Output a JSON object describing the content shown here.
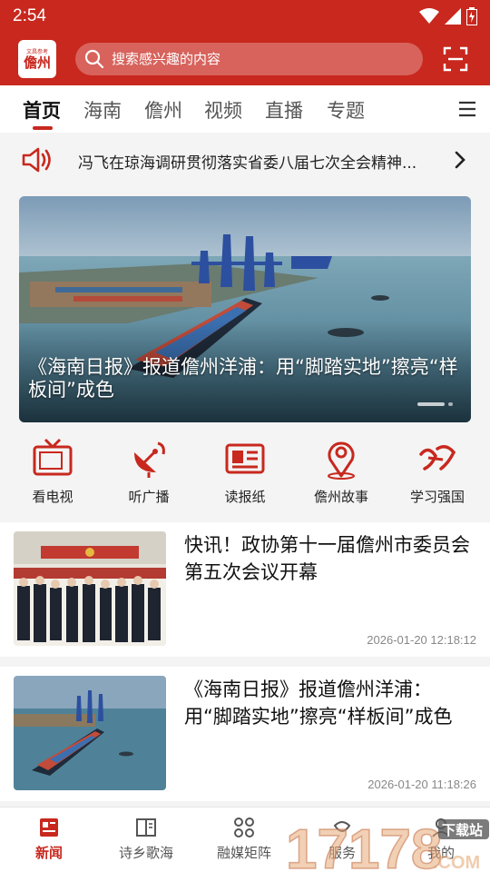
{
  "status_bar": {
    "time": "2:54"
  },
  "header": {
    "logo": {
      "small_text": "文昌参考",
      "big_text": "儋州"
    },
    "search_placeholder": "搜索感兴趣的内容"
  },
  "tabs": [
    {
      "label": "首页",
      "active": true
    },
    {
      "label": "海南",
      "active": false
    },
    {
      "label": "儋州",
      "active": false
    },
    {
      "label": "视频",
      "active": false
    },
    {
      "label": "直播",
      "active": false
    },
    {
      "label": "专题",
      "active": false
    }
  ],
  "notice": {
    "text": "冯飞在琼海调研贯彻落实省委八届七次全会精神..."
  },
  "banner": {
    "caption": "《海南日报》报道儋州洋浦：用“脚踏实地”擦亮“样板间”成色"
  },
  "quick_nav": [
    {
      "label": "看电视",
      "icon": "tv-icon"
    },
    {
      "label": "听广播",
      "icon": "radio-dish-icon"
    },
    {
      "label": "读报纸",
      "icon": "newspaper-icon"
    },
    {
      "label": "儋州故事",
      "icon": "location-pin-icon"
    },
    {
      "label": "学习强国",
      "icon": "xuexi-logo-icon"
    }
  ],
  "news": [
    {
      "title": "快讯！政协第十一届儋州市委员会第五次会议开幕",
      "time": "2026-01-20 12:18:12"
    },
    {
      "title": "《海南日报》报道儋州洋浦：用“脚踏实地”擦亮“样板间”成色",
      "time": "2026-01-20 11:18:26"
    }
  ],
  "bottom_nav": [
    {
      "label": "新闻",
      "icon": "news-icon",
      "active": true
    },
    {
      "label": "诗乡歌海",
      "icon": "book-icon",
      "active": false
    },
    {
      "label": "融媒矩阵",
      "icon": "grid-icon",
      "active": false
    },
    {
      "label": "服务",
      "icon": "service-icon",
      "active": false
    },
    {
      "label": "我的",
      "icon": "user-icon",
      "active": false
    }
  ],
  "watermark": {
    "number": "17178",
    "suffix": ".COM",
    "badge": "下载站"
  },
  "colors": {
    "brand_red": "#c8281e"
  }
}
